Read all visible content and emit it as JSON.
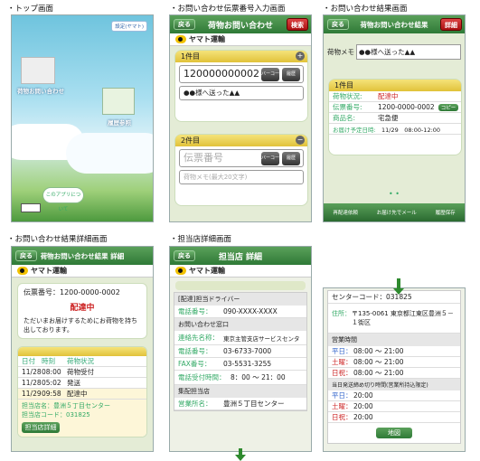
{
  "captions": {
    "top": "・トップ画面",
    "inquiry_input": "・お問い合わせ伝票番号入力画面",
    "inquiry_result": "・お問い合わせ結果画面",
    "result_detail": "・お問い合わせ結果詳細画面",
    "branch_detail": "・担当店詳細画面"
  },
  "common": {
    "back": "戻る",
    "brand": "ヤマト運輸"
  },
  "top": {
    "settings": "設定(ヤマト)",
    "inquiry": "荷物お問い合わせ",
    "history": "履歴参照",
    "about": "このアプリについて"
  },
  "input": {
    "title": "荷物お問い合わせ",
    "search": "検索",
    "sec1": "1件目",
    "slip1": "120000000002",
    "memo1": "●●様へ送った▲▲",
    "sec2": "2件目",
    "slip2_placeholder": "伝票番号",
    "memo2_placeholder": "荷物メモ(最大20文字)",
    "barcode": "バーコード",
    "history_btn": "履歴"
  },
  "result": {
    "title": "荷物お問い合わせ結果",
    "detail": "詳細",
    "memo_label": "荷物メモ",
    "memo": "●●様へ送った▲▲",
    "sec": "1件目",
    "status_label": "荷物状況:",
    "status": "配達中",
    "slip_label": "伝票番号:",
    "slip": "1200-0000-0002",
    "copy": "コピー",
    "item_label": "商品名:",
    "item": "宅急便",
    "date_label": "お届け予定日時:",
    "date": "11/29　08:00-12:00",
    "pager": "• •",
    "f1": "再配達依頼",
    "f2": "お届け先でメール",
    "f3": "履歴保存"
  },
  "detail": {
    "title": "荷物お問い合わせ結果 詳細",
    "slip": "伝票番号：1200-0000-0002",
    "status": "配達中",
    "note": "ただいまお届けするためにお荷物を持ち出しております。",
    "h_date": "日付",
    "h_time": "時刻",
    "h_status": "荷物状況",
    "rows": [
      {
        "d": "11/28",
        "t": "08:00",
        "s": "荷物受付"
      },
      {
        "d": "11/28",
        "t": "05:02",
        "s": "発送"
      },
      {
        "d": "11/29",
        "t": "09:58",
        "s": "配達中"
      }
    ],
    "branch_name": "担当店名：豊洲５丁目センター",
    "branch_code": "担当店コード：031825",
    "branch_btn": "担当店詳細"
  },
  "branch": {
    "title": "担当店 詳細",
    "driver_head": "[配達]担当ドライバー",
    "tel_label": "電話番号：",
    "tel": "090-XXXX-XXXX",
    "window_head": "お問い合わせ窓口",
    "contact_label": "連絡先名称：",
    "contact": "東京主管支店サービスセンタ",
    "tel2_label": "電話番号：",
    "tel2": "03-6733-7000",
    "fax_label": "FAX番号：",
    "fax": "03-5531-3255",
    "hours_label": "電話受付時間：",
    "hours": "8：00 ～ 21：00",
    "store_head": "集配担当店",
    "store_label": "営業所名：",
    "store": "豊洲５丁目センター"
  },
  "branch2": {
    "code": "センターコード：031825",
    "addr_label": "住所：",
    "addr": "〒135-0061 東京都江東区豊洲５－１街区",
    "hours_head": "営業時間",
    "wd": "平日：",
    "wd_v": "08:00 ～ 21:00",
    "sat": "土曜：",
    "sat_v": "08:00 ～ 21:00",
    "sun": "日祝：",
    "sun_v": "08:00 ～ 21:00",
    "cut_head": "当日発送締め切り時間(営業所持込限定)",
    "cwd": "平日：",
    "cwd_v": "20:00",
    "csat": "土曜：",
    "csat_v": "20:00",
    "csun": "日祝：",
    "csun_v": "20:00",
    "map": "地図"
  }
}
